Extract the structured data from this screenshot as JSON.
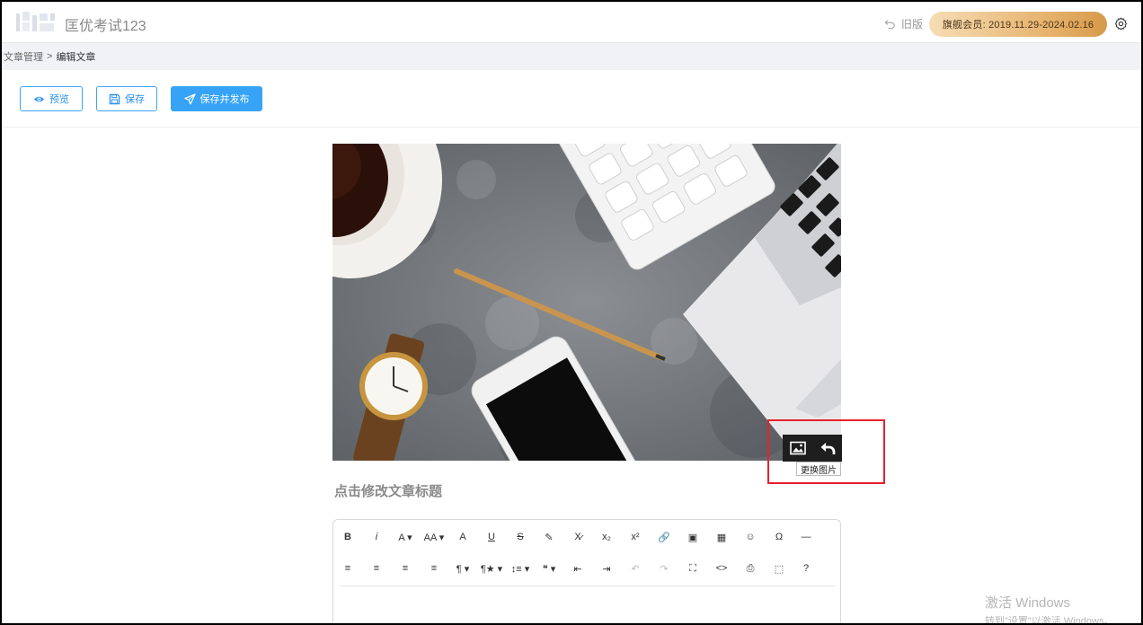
{
  "header": {
    "site_title": "匡优考试123",
    "old_version": "旧版",
    "member_badge": "旗舰会员:  2019.11.29-2024.02.16"
  },
  "breadcrumb": {
    "parent": "文章管理",
    "separator": ">",
    "current": "编辑文章"
  },
  "toolbar": {
    "preview_label": "预览",
    "save_label": "保存",
    "publish_label": "保存并发布"
  },
  "cover": {
    "tooltip": "更换图片"
  },
  "article": {
    "title_placeholder": "点击修改文章标题"
  },
  "editor": {
    "row1": [
      {
        "name": "bold",
        "label": "B"
      },
      {
        "name": "italic",
        "label": "i"
      },
      {
        "name": "font-color",
        "label": "A ▾"
      },
      {
        "name": "font-size",
        "label": "AA ▾"
      },
      {
        "name": "bg-color",
        "label": "A"
      },
      {
        "name": "underline",
        "label": "U"
      },
      {
        "name": "strikethrough",
        "label": "S"
      },
      {
        "name": "highlight",
        "label": "✎"
      },
      {
        "name": "clear-format",
        "label": "X̷"
      },
      {
        "name": "subscript",
        "label": "x₂"
      },
      {
        "name": "superscript",
        "label": "x²"
      },
      {
        "name": "link",
        "label": "🔗"
      },
      {
        "name": "image",
        "label": "▣"
      },
      {
        "name": "table",
        "label": "▦"
      },
      {
        "name": "emoji",
        "label": "☺"
      },
      {
        "name": "special-char",
        "label": "Ω"
      },
      {
        "name": "horizontal-rule",
        "label": "—"
      }
    ],
    "row2": [
      {
        "name": "align-left",
        "label": "≡"
      },
      {
        "name": "align-center",
        "label": "≡"
      },
      {
        "name": "align-right",
        "label": "≡"
      },
      {
        "name": "align-justify",
        "label": "≡"
      },
      {
        "name": "paragraph",
        "label": "¶ ▾"
      },
      {
        "name": "paragraph-style",
        "label": "¶★ ▾"
      },
      {
        "name": "line-height",
        "label": "↕≡ ▾"
      },
      {
        "name": "quote",
        "label": "❝ ▾"
      },
      {
        "name": "outdent",
        "label": "⇤"
      },
      {
        "name": "indent",
        "label": "⇥"
      },
      {
        "name": "undo",
        "label": "↶"
      },
      {
        "name": "redo",
        "label": "↷"
      },
      {
        "name": "fullscreen",
        "label": "⛶"
      },
      {
        "name": "code-view",
        "label": "<>"
      },
      {
        "name": "print",
        "label": "⎙"
      },
      {
        "name": "select-all",
        "label": "⬚"
      },
      {
        "name": "help",
        "label": "?"
      }
    ]
  },
  "watermark": {
    "line1": "激活 Windows",
    "line2": "转到\"设置\"以激活 Windows。"
  }
}
